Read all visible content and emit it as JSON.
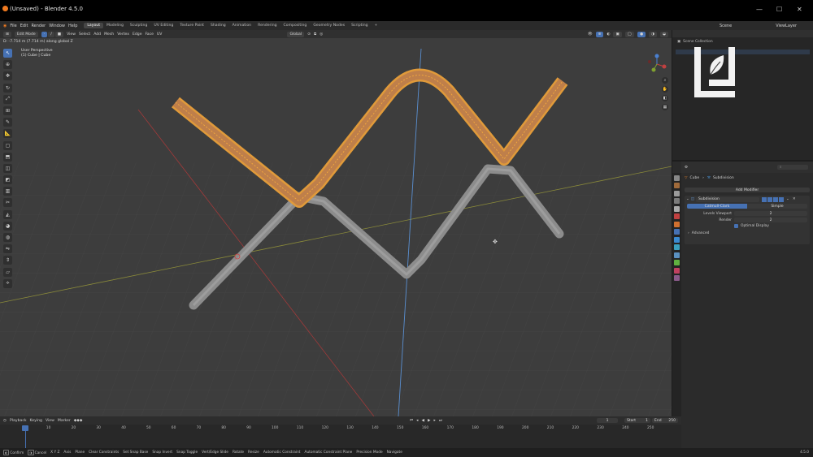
{
  "window": {
    "title": "(Unsaved) - Blender 4.5.0"
  },
  "menus": [
    "File",
    "Edit",
    "Render",
    "Window",
    "Help"
  ],
  "workspaces": [
    "Layout",
    "Modeling",
    "Sculpting",
    "UV Editing",
    "Texture Paint",
    "Shading",
    "Animation",
    "Rendering",
    "Compositing",
    "Geometry Nodes",
    "Scripting"
  ],
  "active_workspace": "Layout",
  "top_right": {
    "scene": "Scene",
    "view_layer": "ViewLayer"
  },
  "viewport_header": {
    "mode": "Edit Mode",
    "menus": [
      "View",
      "Select",
      "Add",
      "Mesh",
      "Vertex",
      "Edge",
      "Face",
      "UV"
    ],
    "orientation": "Global"
  },
  "viewport": {
    "status": "D: -7.714 m (7.714 m) along global Z",
    "perspective": "User Perspective",
    "object": "(1) Cube | Cube"
  },
  "outliner": {
    "title": "Scene Collection"
  },
  "properties": {
    "breadcrumb_object": "Cube",
    "breadcrumb_modifier": "Subdivision",
    "add_modifier": "Add Modifier",
    "modifier_name": "Subdivision",
    "mode_tabs": [
      "Catmull-Clark",
      "Simple"
    ],
    "levels_viewport_label": "Levels Viewport",
    "levels_viewport_value": "2",
    "render_label": "Render",
    "render_value": "2",
    "optimal_display": "Optimal Display",
    "advanced": "Advanced"
  },
  "timeline": {
    "menus": [
      "Playback",
      "Keying",
      "View",
      "Marker"
    ],
    "current_frame": "1",
    "start_label": "Start",
    "start_value": "1",
    "end_label": "End",
    "end_value": "250",
    "ticks": [
      "0",
      "10",
      "20",
      "30",
      "40",
      "50",
      "60",
      "70",
      "80",
      "90",
      "100",
      "110",
      "120",
      "130",
      "140",
      "150",
      "160",
      "170",
      "180",
      "190",
      "200",
      "210",
      "220",
      "230",
      "240",
      "250"
    ]
  },
  "statusbar": {
    "items": [
      "Confirm",
      "Cancel",
      "X Y Z",
      "Axis",
      "Plane",
      "Clear Constraints",
      "Set Snap Base",
      "Snap Invert",
      "Snap Toggle",
      "Vert/Edge Slide",
      "Rotate",
      "Resize",
      "Automatic Constraint",
      "Automatic Constraint Plane",
      "Precision Mode",
      "Navigate"
    ],
    "version": "4.5.0"
  },
  "colors": {
    "accent": "#4671b3",
    "selection": "#f5a623",
    "viewport": "#3d3d3d"
  }
}
